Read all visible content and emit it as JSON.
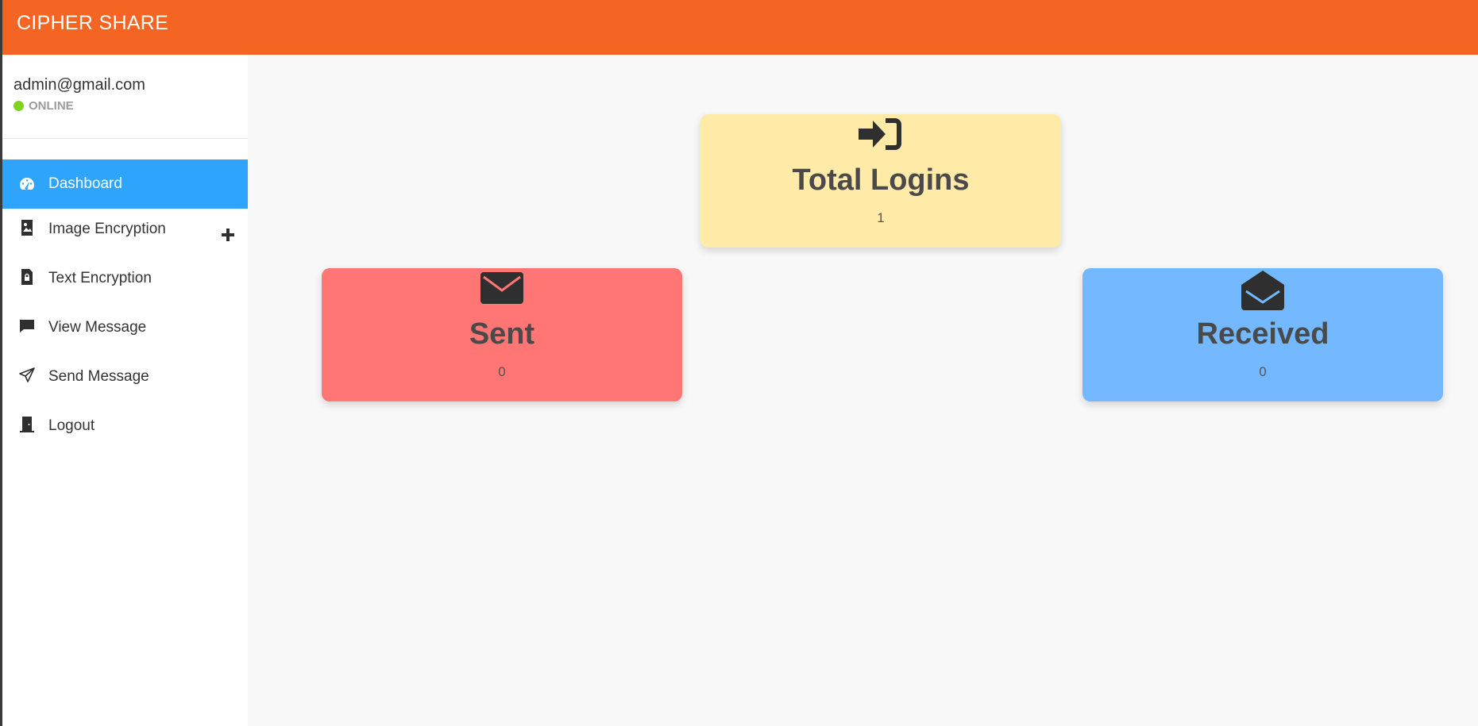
{
  "app": {
    "brand": "CIPHER SHARE"
  },
  "user": {
    "email": "admin@gmail.com",
    "status": "ONLINE"
  },
  "sidebar": {
    "items": [
      {
        "label": "Dashboard",
        "icon": "dashboard-icon",
        "active": true
      },
      {
        "label": "Image Encryption",
        "icon": "image-file-icon",
        "expandable": true
      },
      {
        "label": "Text Encryption",
        "icon": "locked-file-icon"
      },
      {
        "label": "View Message",
        "icon": "message-bubble-icon"
      },
      {
        "label": "Send Message",
        "icon": "paper-plane-icon"
      },
      {
        "label": "Logout",
        "icon": "door-icon"
      }
    ]
  },
  "cards": {
    "total_logins": {
      "title": "Total Logins",
      "value": "1",
      "icon": "sign-in-icon",
      "color": "#ffeaa7"
    },
    "sent": {
      "title": "Sent",
      "value": "0",
      "icon": "envelope-closed-icon",
      "color": "#ff7675"
    },
    "received": {
      "title": "Received",
      "value": "0",
      "icon": "envelope-open-icon",
      "color": "#74b9ff"
    }
  },
  "colors": {
    "header": "#f46524",
    "active_nav": "#2fa4fd",
    "online": "#7ed321"
  }
}
